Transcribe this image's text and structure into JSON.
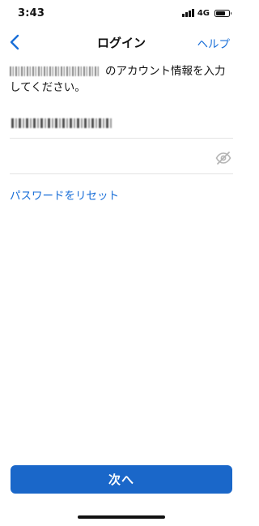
{
  "status_bar": {
    "time": "3:43",
    "network": "4G",
    "battery_level": 0.7
  },
  "nav": {
    "back_icon": "chevron-left-icon",
    "title": "ログイン",
    "help_label": "ヘルプ"
  },
  "instruction": {
    "text": "のアカウント情報を入力してください。"
  },
  "password": {
    "value": "",
    "placeholder": "",
    "toggle_icon": "eye-slash-icon"
  },
  "reset_link": "パスワードをリセット",
  "next_button": "次へ",
  "colors": {
    "accent": "#1a6fd8",
    "button": "#1a67c9"
  }
}
